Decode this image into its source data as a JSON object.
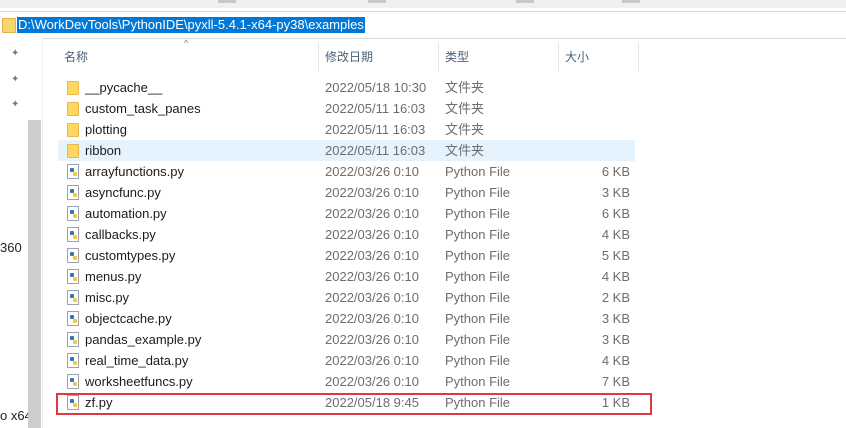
{
  "address_bar": {
    "path": "D:\\WorkDevTools\\PythonIDE\\pyxll-5.4.1-x64-py38\\examples"
  },
  "sidebar": {
    "partial_labels": [
      "360",
      "o x64"
    ]
  },
  "columns": {
    "name": "名称",
    "date": "修改日期",
    "type": "类型",
    "size": "大小"
  },
  "files": [
    {
      "name": "__pycache__",
      "date": "2022/05/18 10:30",
      "type": "文件夹",
      "size": "",
      "kind": "folder"
    },
    {
      "name": "custom_task_panes",
      "date": "2022/05/11 16:03",
      "type": "文件夹",
      "size": "",
      "kind": "folder"
    },
    {
      "name": "plotting",
      "date": "2022/05/11 16:03",
      "type": "文件夹",
      "size": "",
      "kind": "folder"
    },
    {
      "name": "ribbon",
      "date": "2022/05/11 16:03",
      "type": "文件夹",
      "size": "",
      "kind": "folder"
    },
    {
      "name": "arrayfunctions.py",
      "date": "2022/03/26 0:10",
      "type": "Python File",
      "size": "6 KB",
      "kind": "py"
    },
    {
      "name": "asyncfunc.py",
      "date": "2022/03/26 0:10",
      "type": "Python File",
      "size": "3 KB",
      "kind": "py"
    },
    {
      "name": "automation.py",
      "date": "2022/03/26 0:10",
      "type": "Python File",
      "size": "6 KB",
      "kind": "py"
    },
    {
      "name": "callbacks.py",
      "date": "2022/03/26 0:10",
      "type": "Python File",
      "size": "4 KB",
      "kind": "py"
    },
    {
      "name": "customtypes.py",
      "date": "2022/03/26 0:10",
      "type": "Python File",
      "size": "5 KB",
      "kind": "py"
    },
    {
      "name": "menus.py",
      "date": "2022/03/26 0:10",
      "type": "Python File",
      "size": "4 KB",
      "kind": "py"
    },
    {
      "name": "misc.py",
      "date": "2022/03/26 0:10",
      "type": "Python File",
      "size": "2 KB",
      "kind": "py"
    },
    {
      "name": "objectcache.py",
      "date": "2022/03/26 0:10",
      "type": "Python File",
      "size": "3 KB",
      "kind": "py"
    },
    {
      "name": "pandas_example.py",
      "date": "2022/03/26 0:10",
      "type": "Python File",
      "size": "3 KB",
      "kind": "py"
    },
    {
      "name": "real_time_data.py",
      "date": "2022/03/26 0:10",
      "type": "Python File",
      "size": "4 KB",
      "kind": "py"
    },
    {
      "name": "worksheetfuncs.py",
      "date": "2022/03/26 0:10",
      "type": "Python File",
      "size": "7 KB",
      "kind": "py"
    },
    {
      "name": "zf.py",
      "date": "2022/05/18 9:45",
      "type": "Python File",
      "size": "1 KB",
      "kind": "py"
    }
  ],
  "hover_row_index": 3,
  "highlighted_row_index": 15,
  "colors": {
    "selection": "#0078d7",
    "hover": "#e5f3ff",
    "highlight_box": "#e0383e",
    "header_text": "#4c607a"
  },
  "icons": {
    "folder": "folder-icon",
    "python": "python-file-icon",
    "pin": "pin-icon"
  }
}
